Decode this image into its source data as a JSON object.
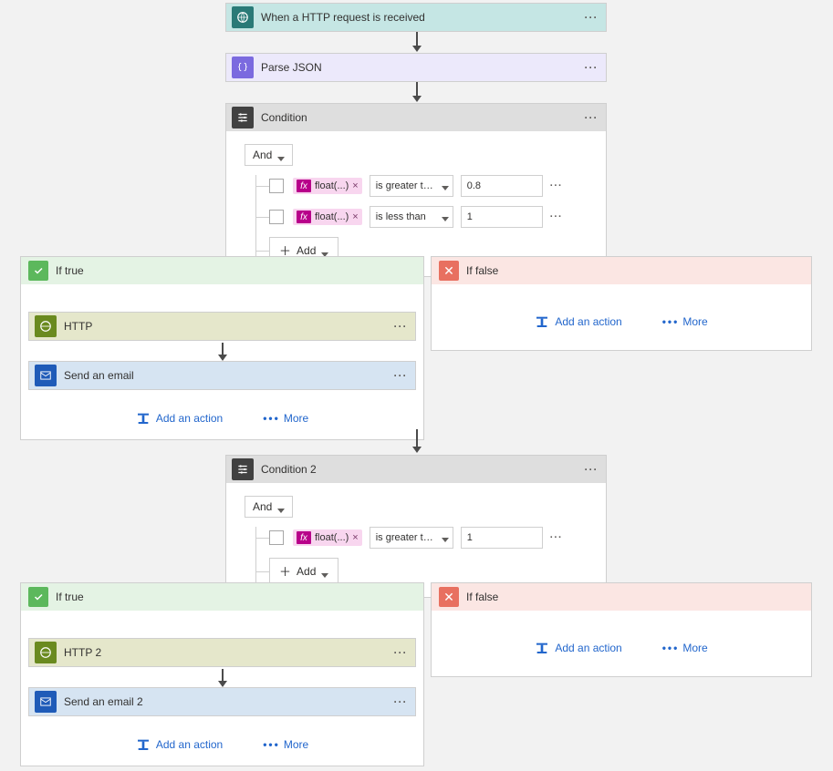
{
  "trigger": {
    "title": "When a HTTP request is received"
  },
  "parse_json": {
    "title": "Parse JSON"
  },
  "condition1": {
    "title": "Condition",
    "group_op": "And",
    "rows": [
      {
        "pill": "float(...)",
        "operator": "is greater than o...",
        "value": "0.8"
      },
      {
        "pill": "float(...)",
        "operator": "is less than",
        "value": "1"
      }
    ],
    "add_label": "Add"
  },
  "branch1": {
    "true_label": "If true",
    "false_label": "If false",
    "true_actions": {
      "http": {
        "title": "HTTP"
      },
      "email": {
        "title": "Send an email"
      }
    },
    "add_action": "Add an action",
    "more": "More"
  },
  "condition2": {
    "title": "Condition 2",
    "group_op": "And",
    "rows": [
      {
        "pill": "float(...)",
        "operator": "is greater than o...",
        "value": "1"
      }
    ],
    "add_label": "Add"
  },
  "branch2": {
    "true_label": "If true",
    "false_label": "If false",
    "true_actions": {
      "http": {
        "title": "HTTP 2"
      },
      "email": {
        "title": "Send an email 2"
      }
    },
    "add_action": "Add an action",
    "more": "More"
  }
}
